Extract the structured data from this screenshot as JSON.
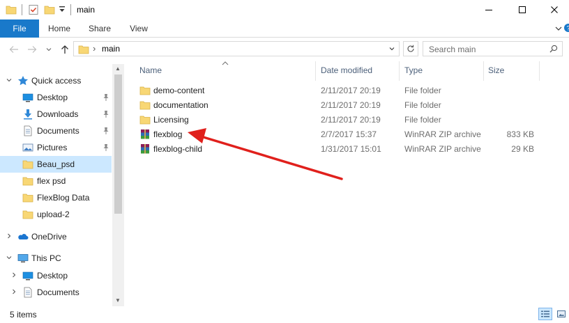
{
  "window": {
    "title": "main",
    "colors": {
      "accent": "#1979ca",
      "selection": "#cce8ff",
      "folder": "#f8d775",
      "arrow": "#e0201c"
    }
  },
  "ribbon": {
    "tabs": [
      "File",
      "Home",
      "Share",
      "View"
    ]
  },
  "address": {
    "path": "main",
    "search_placeholder": "Search main"
  },
  "navpane": {
    "quick_access": "Quick access",
    "items": [
      {
        "label": "Desktop",
        "icon": "desktop-icon",
        "pinned": true
      },
      {
        "label": "Downloads",
        "icon": "downloads-icon",
        "pinned": true
      },
      {
        "label": "Documents",
        "icon": "documents-icon",
        "pinned": true
      },
      {
        "label": "Pictures",
        "icon": "pictures-icon",
        "pinned": true
      },
      {
        "label": "Beau_psd",
        "icon": "folder-icon",
        "selected": true
      },
      {
        "label": "flex psd",
        "icon": "folder-icon"
      },
      {
        "label": "FlexBlog Data",
        "icon": "folder-icon"
      },
      {
        "label": "upload-2",
        "icon": "folder-icon"
      }
    ],
    "onedrive": "OneDrive",
    "this_pc": "This PC",
    "this_pc_items": [
      {
        "label": "Desktop",
        "icon": "desktop-icon"
      },
      {
        "label": "Documents",
        "icon": "documents-icon"
      }
    ]
  },
  "filelist": {
    "columns": [
      "Name",
      "Date modified",
      "Type",
      "Size"
    ],
    "rows": [
      {
        "name": "demo-content",
        "date": "2/11/2017 20:19",
        "type": "File folder",
        "size": "",
        "icon": "folder-icon"
      },
      {
        "name": "documentation",
        "date": "2/11/2017 20:19",
        "type": "File folder",
        "size": "",
        "icon": "folder-icon"
      },
      {
        "name": "Licensing",
        "date": "2/11/2017 20:19",
        "type": "File folder",
        "size": "",
        "icon": "folder-icon"
      },
      {
        "name": "flexblog",
        "date": "2/7/2017 15:37",
        "type": "WinRAR ZIP archive",
        "size": "833 KB",
        "icon": "winrar-archive-icon"
      },
      {
        "name": "flexblog-child",
        "date": "1/31/2017 15:01",
        "type": "WinRAR ZIP archive",
        "size": "29 KB",
        "icon": "winrar-archive-icon"
      }
    ]
  },
  "status": {
    "items_count": "5 items"
  }
}
